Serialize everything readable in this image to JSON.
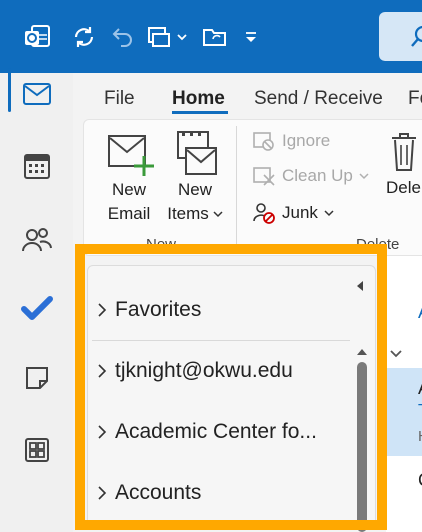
{
  "ribbon_tabs": [
    "File",
    "Home",
    "Send / Receive",
    "Fo"
  ],
  "ribbon": {
    "new_email": [
      "New",
      "Email"
    ],
    "new_items": [
      "New",
      "Items"
    ],
    "new_group_label": "New",
    "ignore": "Ignore",
    "clean_up": "Clean Up",
    "junk": "Junk",
    "delete_partial": "Dele",
    "delete_group_label": "Delete"
  },
  "folder_pane": {
    "items": [
      "Favorites",
      "tjknight@okwu.edu",
      "Academic Center fo...",
      "Accounts"
    ]
  },
  "mail_list": {
    "partial_labels": [
      "A",
      "A",
      "T",
      "H",
      "C"
    ]
  },
  "colors": {
    "accent": "#0f6cbd",
    "highlight_frame": "#ffa800",
    "check_icon": "#2b6fd6"
  },
  "icons": [
    "outlook-logo-icon",
    "sync-icon",
    "undo-icon",
    "print-icon",
    "move-folder-icon",
    "dropdown-icon",
    "search-icon",
    "mail-icon",
    "calendar-icon",
    "people-icon",
    "todo-icon",
    "notes-icon",
    "apps-icon"
  ]
}
